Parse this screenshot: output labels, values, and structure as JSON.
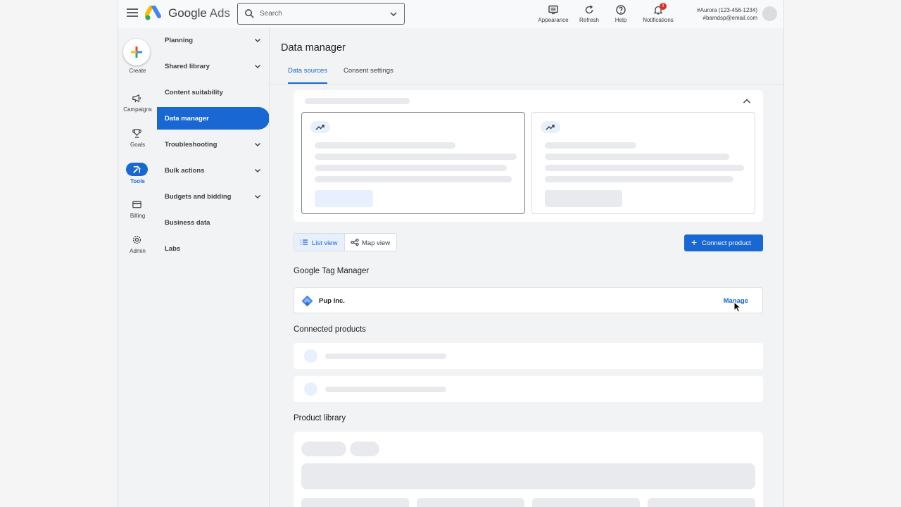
{
  "header": {
    "product_name_main": "Google",
    "product_name_sub": "Ads",
    "search_placeholder": "Search",
    "buttons": [
      {
        "label": "Appearance",
        "icon": "appearance-icon"
      },
      {
        "label": "Refresh",
        "icon": "refresh-icon"
      },
      {
        "label": "Help",
        "icon": "help-icon"
      },
      {
        "label": "Notifications",
        "icon": "bell-icon",
        "badge": "!"
      }
    ],
    "account": {
      "name": "#Aurora (123-456-1234)",
      "email": "#bamdsp@email.com"
    }
  },
  "rail": {
    "create_label": "Create",
    "items": [
      {
        "label": "Campaigns",
        "icon": "megaphone-icon"
      },
      {
        "label": "Goals",
        "icon": "trophy-icon"
      },
      {
        "label": "Tools",
        "icon": "tools-icon",
        "active": true
      },
      {
        "label": "Billing",
        "icon": "credit-card-icon"
      },
      {
        "label": "Admin",
        "icon": "gear-icon"
      }
    ]
  },
  "nav": {
    "items": [
      {
        "label": "Planning",
        "expandable": true
      },
      {
        "label": "Shared library",
        "expandable": true
      },
      {
        "label": "Content suitability",
        "expandable": false
      },
      {
        "label": "Data manager",
        "expandable": false,
        "active": true
      },
      {
        "label": "Troubleshooting",
        "expandable": true
      },
      {
        "label": "Bulk actions",
        "expandable": true
      },
      {
        "label": "Budgets and bidding",
        "expandable": true
      },
      {
        "label": "Business data",
        "expandable": false
      },
      {
        "label": "Labs",
        "expandable": false
      }
    ]
  },
  "main": {
    "title": "Data manager",
    "tabs": [
      {
        "label": "Data sources",
        "active": true
      },
      {
        "label": "Consent settings",
        "active": false
      }
    ],
    "view_toggle": {
      "list_label": "List view",
      "map_label": "Map view",
      "selected": "list"
    },
    "connect_button_label": "Connect product",
    "gtm": {
      "section_title": "Google Tag Manager",
      "account_name": "Pup Inc.",
      "manage_label": "Manage"
    },
    "connected_section_title": "Connected products",
    "library_section_title": "Product library"
  },
  "colors": {
    "accent": "#1967d2",
    "skeleton": "#e8eaed",
    "skeleton_blue": "#e8f0fe",
    "badge": "#d93025"
  }
}
